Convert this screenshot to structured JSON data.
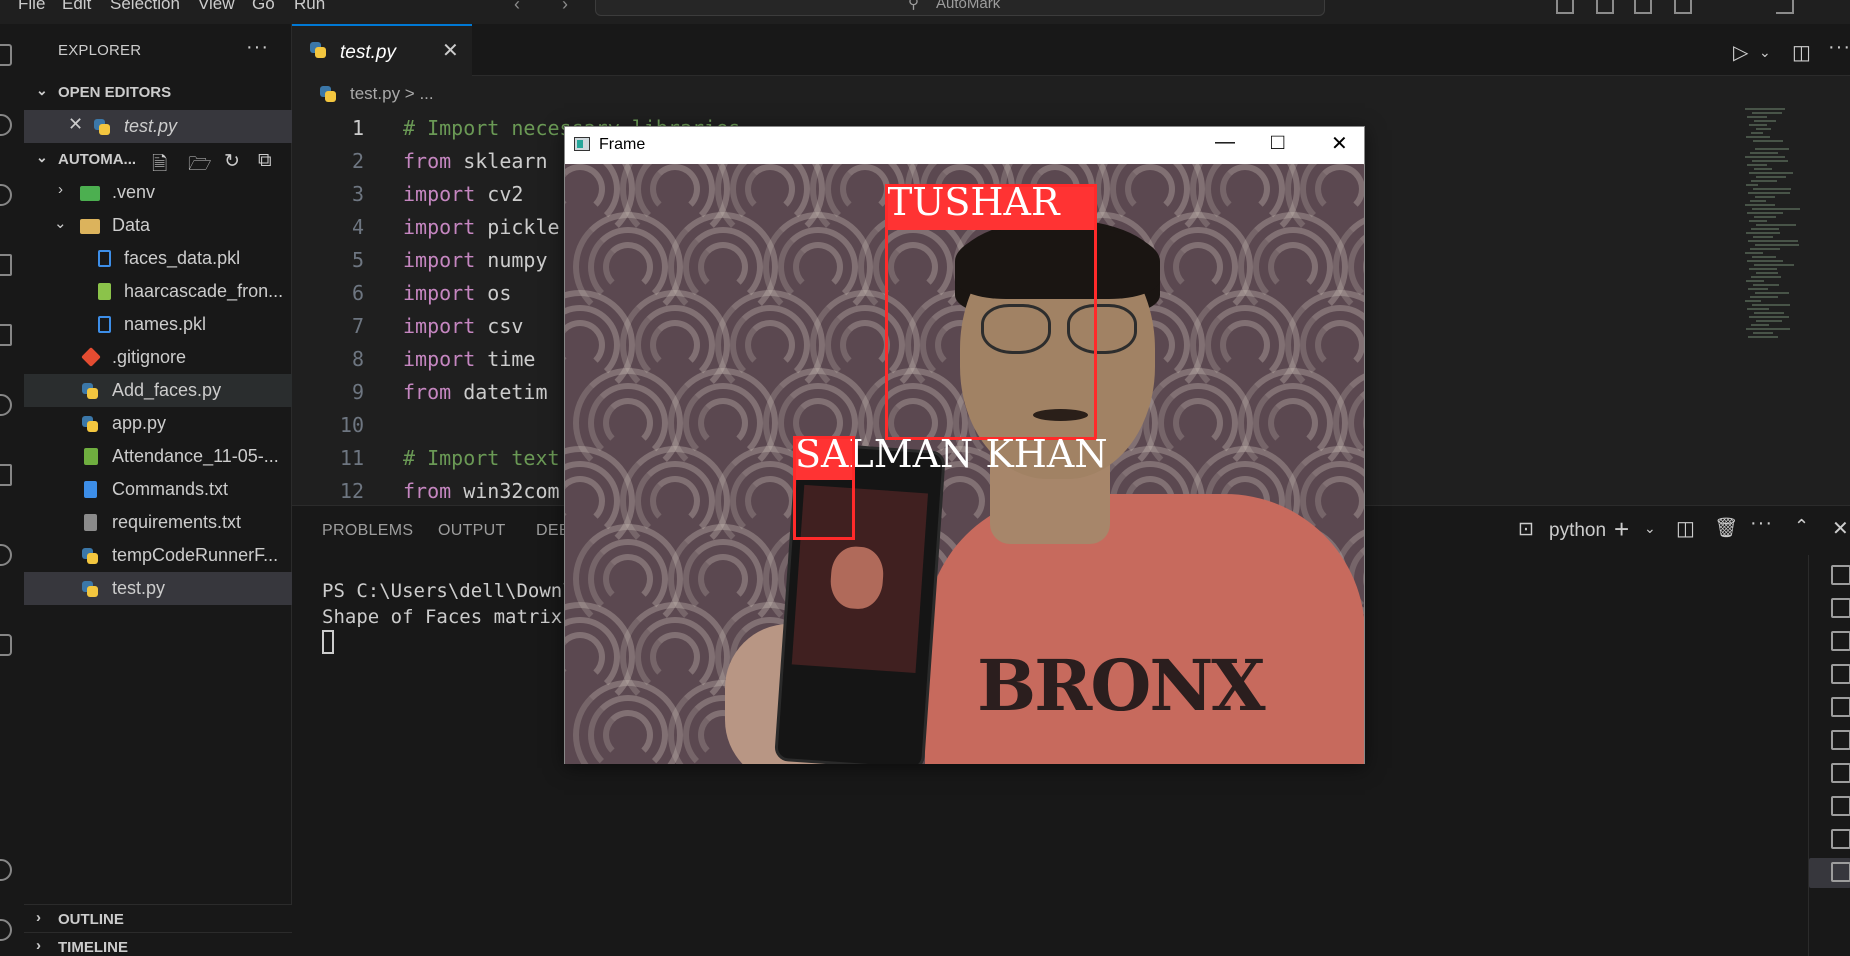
{
  "menu": [
    "File",
    "Edit",
    "Selection",
    "View",
    "Go",
    "Run"
  ],
  "command_center": {
    "label": "AutoMark"
  },
  "sidebar": {
    "title": "EXPLORER",
    "open_editors_label": "OPEN EDITORS",
    "open_editors": [
      {
        "label": "test.py"
      }
    ],
    "project_label": "AUTOMA...",
    "tree": [
      {
        "label": ".venv"
      },
      {
        "label": "Data"
      },
      {
        "label": "faces_data.pkl"
      },
      {
        "label": "haarcascade_fron..."
      },
      {
        "label": "names.pkl"
      },
      {
        "label": ".gitignore"
      },
      {
        "label": "Add_faces.py"
      },
      {
        "label": "app.py"
      },
      {
        "label": "Attendance_11-05-..."
      },
      {
        "label": "Commands.txt"
      },
      {
        "label": "requirements.txt"
      },
      {
        "label": "tempCodeRunnerF..."
      },
      {
        "label": "test.py"
      }
    ],
    "outline_label": "OUTLINE",
    "timeline_label": "TIMELINE"
  },
  "editor": {
    "tab_label": "test.py",
    "breadcrumb": "test.py > ...",
    "lines": [
      {
        "no": "1",
        "text": "# Import necessary libraries"
      },
      {
        "no": "2",
        "kw": "from",
        "rest": " sklearn"
      },
      {
        "no": "3",
        "kw": "import",
        "rest": " cv2"
      },
      {
        "no": "4",
        "kw": "import",
        "rest": " pickle"
      },
      {
        "no": "5",
        "kw": "import",
        "rest": " numpy"
      },
      {
        "no": "6",
        "kw": "import",
        "rest": " os"
      },
      {
        "no": "7",
        "kw": "import",
        "rest": " csv"
      },
      {
        "no": "8",
        "kw": "import",
        "rest": " time"
      },
      {
        "no": "9",
        "kw": "from",
        "rest": " datetim"
      },
      {
        "no": "10",
        "text": ""
      },
      {
        "no": "11",
        "text": "# Import text"
      },
      {
        "no": "12",
        "kw": "from",
        "rest": " win32com"
      }
    ]
  },
  "panel": {
    "tabs": [
      "PROBLEMS",
      "OUTPUT",
      "DEBU"
    ],
    "terminal_name": "python",
    "lines": [
      "PS C:\\Users\\dell\\Downl",
      "Shape of Faces matrix"
    ]
  },
  "frame_window": {
    "title": "Frame",
    "detections": [
      {
        "name": "TUSHAR"
      },
      {
        "name": "SALMAN KHAN"
      }
    ],
    "shirt_text": "BRONX"
  },
  "colors": {
    "accent": "#0078d4",
    "detection_box": "#ff2a2a",
    "keyword": "#c586c0",
    "comment": "#6a9955"
  }
}
